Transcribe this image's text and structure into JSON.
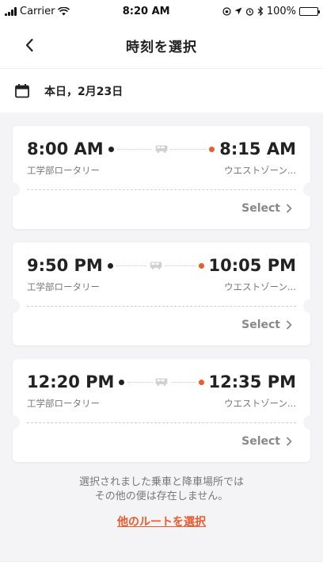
{
  "status_bar": {
    "carrier": "Carrier",
    "time": "8:20 AM",
    "battery": "100%"
  },
  "nav": {
    "title": "時刻を選択",
    "back_icon": "chevron-left-icon"
  },
  "date_bar": {
    "icon": "calendar-icon",
    "text": "本日，2月23日"
  },
  "trips": [
    {
      "depart": "8:00 AM",
      "arrive": "8:15 AM",
      "from": "工学部ロータリー",
      "to": "ウエストゾーン...",
      "select_label": "Select"
    },
    {
      "depart": "9:50 PM",
      "arrive": "10:05 PM",
      "from": "工学部ロータリー",
      "to": "ウエストゾーン...",
      "select_label": "Select"
    },
    {
      "depart": "12:20 PM",
      "arrive": "12:35 PM",
      "from": "工学部ロータリー",
      "to": "ウエストゾーン...",
      "select_label": "Select"
    }
  ],
  "footer": {
    "line1": "選択されました乗車と降車場所では",
    "line2": "その他の便は存在しません。",
    "link": "他のルートを選択"
  },
  "colors": {
    "accent": "#ee5a2a",
    "background": "#f4f4f6"
  }
}
